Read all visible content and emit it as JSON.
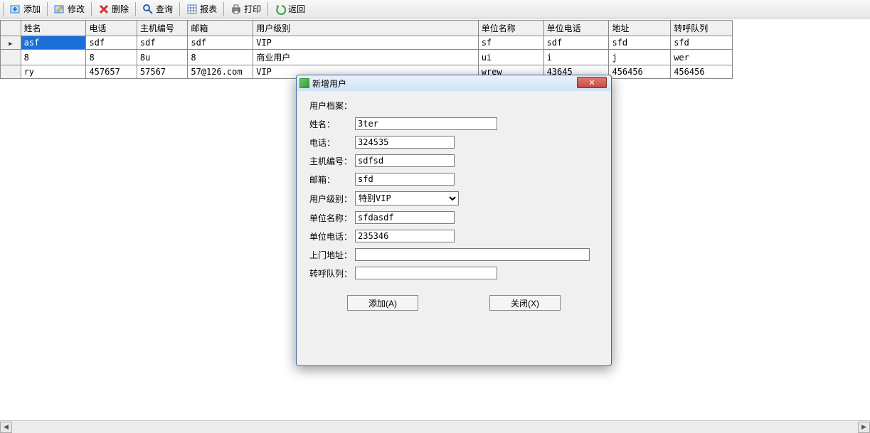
{
  "toolbar": {
    "add": "添加",
    "edit": "修改",
    "delete": "删除",
    "query": "查询",
    "report": "报表",
    "print": "打印",
    "back": "返回"
  },
  "grid": {
    "headers": [
      "姓名",
      "电话",
      "主机编号",
      "邮箱",
      "用户级别",
      "单位名称",
      "单位电话",
      "地址",
      "转呼队列"
    ],
    "rows": [
      {
        "name": "asf",
        "phone": "sdf",
        "host": "sdf",
        "mail": "sdf",
        "level": "VIP",
        "org": "sf",
        "orgphone": "sdf",
        "addr": "sfd",
        "queue": "sfd"
      },
      {
        "name": "8",
        "phone": "8",
        "host": "8u",
        "mail": "8",
        "level": "商业用户",
        "org": "ui",
        "orgphone": "i",
        "addr": "j",
        "queue": "wer"
      },
      {
        "name": "ry",
        "phone": "457657",
        "host": "57567",
        "mail": "57@126.com",
        "level": "VIP",
        "org": "wrew",
        "orgphone": "43645",
        "addr": "456456",
        "queue": "456456"
      }
    ]
  },
  "dialog": {
    "title": "新增用户",
    "section": "用户档案：",
    "labels": {
      "name": "姓名：",
      "phone": "电话：",
      "host": "主机编号：",
      "mail": "邮箱：",
      "level": "用户级别：",
      "org": "单位名称：",
      "orgphone": "单位电话：",
      "addr": "上门地址：",
      "queue": "转呼队列："
    },
    "values": {
      "name": "3ter",
      "phone": "324535",
      "host": "sdfsd",
      "mail": "sfd",
      "level": "特别VIP",
      "org": "sfdasdf",
      "orgphone": "235346",
      "addr": "",
      "queue": ""
    },
    "buttons": {
      "add": "添加(A)",
      "close": "关闭(X)"
    }
  }
}
